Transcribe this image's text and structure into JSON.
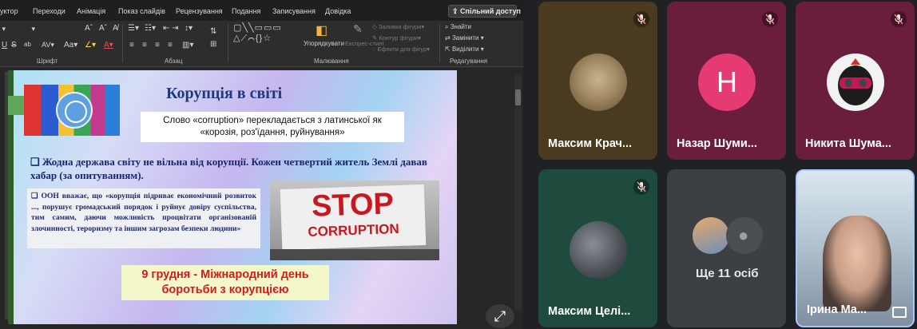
{
  "ribbon": {
    "tabs": [
      "уктор",
      "Переходи",
      "Анімація",
      "Показ слайдів",
      "Рецензування",
      "Подання",
      "Записування",
      "Довідка"
    ],
    "share_label": "Спільний доступ",
    "groups": [
      "Шрифт",
      "Абзац",
      "Малювання",
      "Редагування"
    ],
    "arrange_label": "Упорядкувати",
    "quick_styles_label": "Експрес-стилі",
    "fill_label": "Заливка фігури",
    "outline_label": "Контур фігури",
    "effects_label": "Ефекти для фігур",
    "find_label": "Знайти",
    "replace_label": "Замінити",
    "select_label": "Виділити"
  },
  "slide": {
    "title": "Корупція в світі",
    "box1_line1": "Слово «corruption» перекладається з латинської як",
    "box1_line2": "«корозія, роз'їдання, руйнування»",
    "para1": "❑ Жодна держава світу не вільна від корупції. Кожен четвертий житель Землі давав хабар (за опитуванням).",
    "quote": "❑ ООН вважає, що «корупція підриває економічний розвиток ..., порушує громадський порядок і руйнує довіру суспільства, тим самим, даючи можливість процвітати організованій злочинності, тероризму та іншим загрозам безпеки людини»",
    "date_line1": "9 грудня - Міжнародний день",
    "date_line2": "боротьби з корупцією",
    "stop_text1": "STOP",
    "stop_text2": "CORRUPTION"
  },
  "participants": [
    {
      "name": "Максим Крач...",
      "muted": true
    },
    {
      "name": "Назар Шуми...",
      "muted": true,
      "initial": "Н"
    },
    {
      "name": "Никита Шума...",
      "muted": true
    },
    {
      "name": "Максим Целі...",
      "muted": true
    },
    {
      "name": "Ірина Ма...",
      "muted": false
    }
  ],
  "more": {
    "label": "Ще 11 осіб"
  },
  "colors": {
    "tile_1": "#4a3a20",
    "tile_2": "#6b1d3e",
    "tile_3": "#6b1d3e",
    "tile_4": "#1f4a3e",
    "tile_5": "#3c4043",
    "avatar_h": "#e63a73",
    "active_border": "#a8c7fa"
  }
}
